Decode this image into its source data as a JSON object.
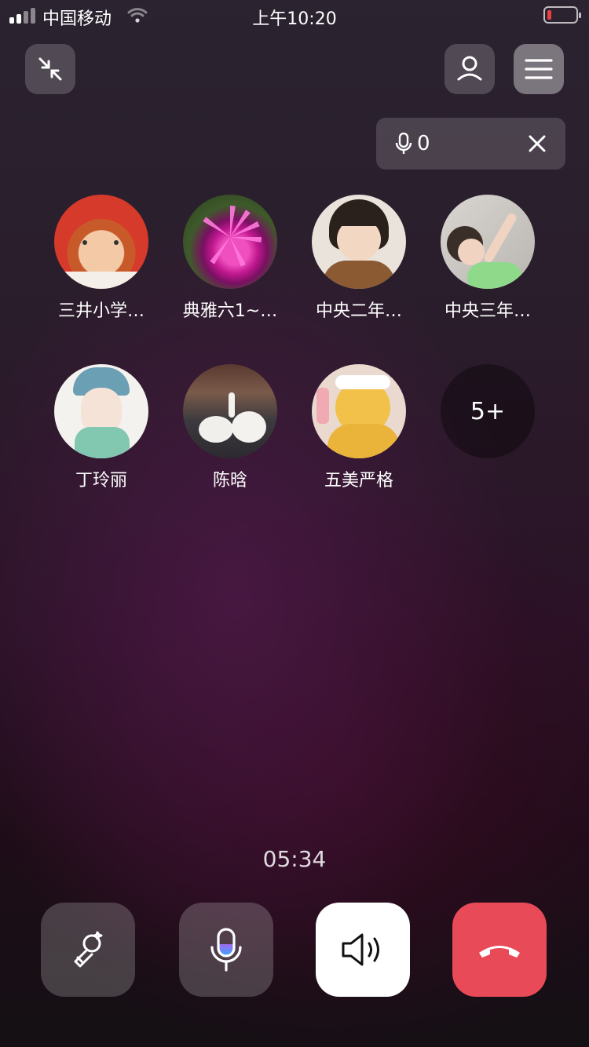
{
  "status_bar": {
    "carrier": "中国移动",
    "time": "上午10:20"
  },
  "mic_indicator": {
    "count": "0"
  },
  "participants": [
    {
      "name": "三井小学…",
      "avatar": "doll-avatar"
    },
    {
      "name": "典雅六1~…",
      "avatar": "flower-avatar"
    },
    {
      "name": "中央二年…",
      "avatar": "child-avatar"
    },
    {
      "name": "中央三年…",
      "avatar": "baby-avatar"
    },
    {
      "name": "丁玲丽",
      "avatar": "illustration-avatar"
    },
    {
      "name": "陈晗",
      "avatar": "swans-avatar"
    },
    {
      "name": "五美严格",
      "avatar": "bear-avatar"
    }
  ],
  "more_participants": "5+",
  "call_timer": "05:34",
  "controls": {
    "hangup_color": "#e84a58",
    "speaker_bg": "#ffffff"
  }
}
